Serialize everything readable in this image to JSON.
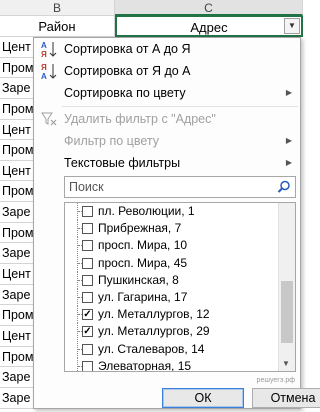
{
  "columns": {
    "b": "B",
    "c": "C"
  },
  "header": {
    "b_label": "Район",
    "c_label": "Адрес",
    "filter_button": "▼"
  },
  "rows": [
    "Цент",
    "Пром",
    "Заре",
    "Пром",
    "Цент",
    "Пром",
    "Цент",
    "Пром",
    "Заре",
    "Пром",
    "Заре",
    "Цент",
    "Заре",
    "Пром",
    "Цент",
    "Пром",
    "Заре",
    "Заре",
    "Цент"
  ],
  "menu": {
    "sort_asc": "Сортировка от А до Я",
    "sort_desc": "Сортировка от Я до А",
    "sort_by_color": "Сортировка по цвету",
    "clear_filter": "Удалить фильтр с \"Адрес\"",
    "filter_by_color": "Фильтр по цвету",
    "text_filters": "Текстовые фильтры",
    "search_placeholder": "Поиск",
    "ok": "ОК",
    "cancel": "Отмена"
  },
  "list_items": [
    {
      "label": "пл. Революции, 1",
      "checked": false
    },
    {
      "label": "Прибрежная, 7",
      "checked": false
    },
    {
      "label": "просп. Мира, 10",
      "checked": false
    },
    {
      "label": "просп. Мира, 45",
      "checked": false
    },
    {
      "label": "Пушкинская, 8",
      "checked": false
    },
    {
      "label": "ул. Гагарина, 17",
      "checked": false
    },
    {
      "label": "ул. Металлургов, 12",
      "checked": true
    },
    {
      "label": "ул. Металлургов, 29",
      "checked": true
    },
    {
      "label": "ул. Сталеваров, 14",
      "checked": false
    },
    {
      "label": "Элеваторная, 15",
      "checked": false
    }
  ],
  "watermark": "решуегэ.рф",
  "colors": {
    "accent": "#217346",
    "icon_blue": "#2a5bbf",
    "disabled": "#a0a0a0"
  }
}
